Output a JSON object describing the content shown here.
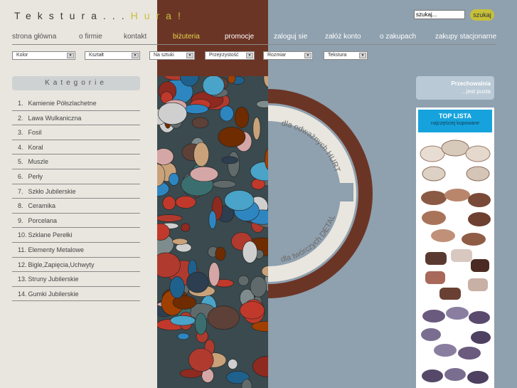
{
  "colors": {
    "accent": "#c7c03a",
    "brown": "#6b3526",
    "blue_gray": "#8fa0ae",
    "beige": "#e9e6df",
    "top_blue": "#16a3dd"
  },
  "header": {
    "logo_part1": "Teksturа...",
    "logo_part2": "Hura!"
  },
  "search": {
    "placeholder": "szukaj...",
    "button": "szukaj"
  },
  "nav": [
    {
      "label": "strona główna"
    },
    {
      "label": "o firmie"
    },
    {
      "label": "kontakt"
    },
    {
      "label": "biżuteria",
      "active": true
    },
    {
      "label": "promocje"
    },
    {
      "label": "zaloguj sie"
    },
    {
      "label": "załóż konto"
    },
    {
      "label": "o zakupach"
    },
    {
      "label": "zakupy stacjonarne"
    }
  ],
  "filters": [
    {
      "label": "Kolor"
    },
    {
      "label": "Kształt"
    },
    {
      "label": "Na sztuki"
    },
    {
      "label": "Przejrzystość"
    },
    {
      "label": "Rozmiar"
    },
    {
      "label": "Tekstura"
    }
  ],
  "categories": {
    "title": "Kategorie",
    "items": [
      {
        "num": "1.",
        "label": "Kamienie Półszlachetne"
      },
      {
        "num": "2.",
        "label": "Lawa Wulkaniczna"
      },
      {
        "num": "3.",
        "label": "Fosil"
      },
      {
        "num": "4.",
        "label": "Koral"
      },
      {
        "num": "5.",
        "label": "Muszle"
      },
      {
        "num": "6.",
        "label": "Perły"
      },
      {
        "num": "7.",
        "label": "Szkło Jubilerskie"
      },
      {
        "num": "8.",
        "label": "Ceramika"
      },
      {
        "num": "9.",
        "label": "Porcelana"
      },
      {
        "num": "10.",
        "label": "Szklane Perełki"
      },
      {
        "num": "11.",
        "label": "Elementy Metalowe"
      },
      {
        "num": "12.",
        "label": "Bigle,Zapięcia,Uchwyty"
      },
      {
        "num": "13.",
        "label": "Struny Jubilerskie"
      },
      {
        "num": "14.",
        "label": "Gumki Jubilerskie"
      }
    ]
  },
  "ring": {
    "hurt": "dla odważnych HURT",
    "detal": "dla twórczych DETAL"
  },
  "storage": {
    "title": "Przechowalnia",
    "status": "...jest pusta"
  },
  "toplist": {
    "title": "TOP LISTA",
    "subtitle": "najczęściej kupowane"
  }
}
